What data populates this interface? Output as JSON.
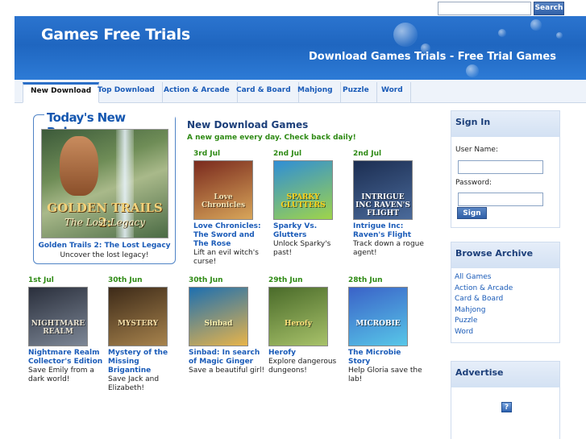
{
  "search": {
    "placeholder": "",
    "button_label": "Search"
  },
  "header": {
    "title": "Games Free Trials",
    "tagline": "Download Games Trials - Free Trial Games"
  },
  "nav": {
    "tabs": [
      {
        "label": "New Download",
        "active": true
      },
      {
        "label": "Top Download"
      },
      {
        "label": "Action & Arcade"
      },
      {
        "label": "Card & Board"
      },
      {
        "label": "Mahjong"
      },
      {
        "label": "Puzzle"
      },
      {
        "label": "Word"
      }
    ]
  },
  "featured": {
    "heading": "Today's New Release",
    "image_title": "GOLDEN TRAILS 2:",
    "image_subtitle": "The Lost Legacy",
    "name": "Golden Trails 2: The Lost Legacy",
    "desc": "Uncover the lost legacy!"
  },
  "main": {
    "title": "New Download Games",
    "subtitle": "A new game every day. Check back daily!",
    "games": [
      {
        "date": "3rd Jul",
        "name": "Love Chronicles: The Sword and The Rose",
        "desc": "Lift an evil witch's curse!",
        "art": "Love Chronicles",
        "color1": "#7a2a1e",
        "color2": "#d8a65a",
        "textcolor": "#f5e6b8"
      },
      {
        "date": "2nd Jul",
        "name": "Sparky Vs. Glutters",
        "desc": "Unlock Sparky's past!",
        "art": "SPARKY GLUTTERS",
        "color1": "#2f8ed6",
        "color2": "#9fd44a",
        "textcolor": "#ffd21a"
      },
      {
        "date": "2nd Jul",
        "name": "Intrigue Inc: Raven's Flight",
        "desc": "Track down a rogue agent!",
        "art": "INTRIGUE INC RAVEN'S FLIGHT",
        "color1": "#1c2e52",
        "color2": "#4a6a9a",
        "textcolor": "#ffffff"
      },
      {
        "date": "1st Jul",
        "name": "Nightmare Realm Collector's Edition",
        "desc": "Save Emily from a dark world!",
        "art": "NIGHTMARE REALM",
        "color1": "#2a2f3c",
        "color2": "#7d8796",
        "textcolor": "#e9e2d0"
      },
      {
        "date": "30th Jun",
        "name": "Mystery of the Missing Brigantine",
        "desc": "Save Jack and Elizabeth!",
        "art": "MYSTERY",
        "color1": "#3d2a18",
        "color2": "#a7834d",
        "textcolor": "#f3dea8"
      },
      {
        "date": "30th Jun",
        "name": "Sinbad: In search of Magic Ginger",
        "desc": "Save a beautiful girl!",
        "art": "Sinbad",
        "color1": "#1d6fb0",
        "color2": "#e8b44a",
        "textcolor": "#fff3b0"
      },
      {
        "date": "29th Jun",
        "name": "Herofy",
        "desc": "Explore dangerous dungeons!",
        "art": "Herofy",
        "color1": "#4a6b2a",
        "color2": "#a8c26a",
        "textcolor": "#ffe07a"
      },
      {
        "date": "28th Jun",
        "name": "The Microbie Story",
        "desc": "Help Gloria save the lab!",
        "art": "MICROBIE",
        "color1": "#3a62c8",
        "color2": "#58c7e8",
        "textcolor": "#ffffff"
      }
    ]
  },
  "sidebar": {
    "signin": {
      "title": "Sign In",
      "username_label": "User Name:",
      "password_label": "Password:",
      "button_label": "Sign In"
    },
    "archive": {
      "title": "Browse Archive",
      "links": [
        "All Games",
        "Action & Arcade",
        "Card & Board",
        "Mahjong",
        "Puzzle",
        "Word"
      ]
    },
    "advertise": {
      "title": "Advertise",
      "icon": "?"
    }
  },
  "colors": {
    "brand_blue": "#2b74cf",
    "link": "#1a5bb8",
    "date_green": "#2e8a14"
  }
}
